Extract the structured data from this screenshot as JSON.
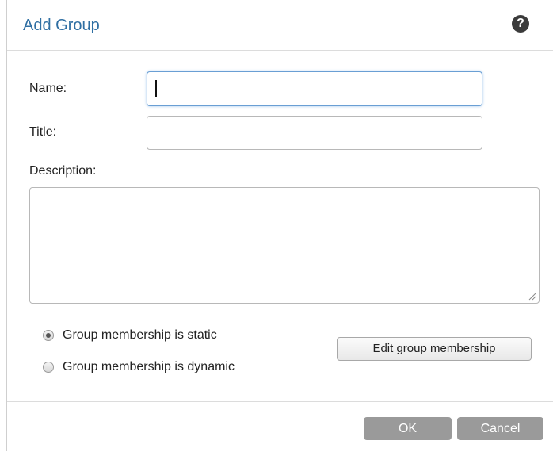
{
  "dialog": {
    "title": "Add Group",
    "help_icon": "question-circle-icon",
    "help_symbol": "?"
  },
  "form": {
    "name_label": "Name:",
    "name_value": "",
    "title_label": "Title:",
    "title_value": "",
    "description_label": "Description:",
    "description_value": ""
  },
  "membership": {
    "options": [
      {
        "label": "Group membership is static",
        "checked": true
      },
      {
        "label": "Group membership is dynamic",
        "checked": false
      }
    ],
    "edit_button_label": "Edit group membership"
  },
  "footer": {
    "ok_label": "OK",
    "cancel_label": "Cancel"
  },
  "colors": {
    "title": "#2f6fa3",
    "focus_border": "#6a9fd4",
    "footer_button": "#9a9a9a"
  }
}
